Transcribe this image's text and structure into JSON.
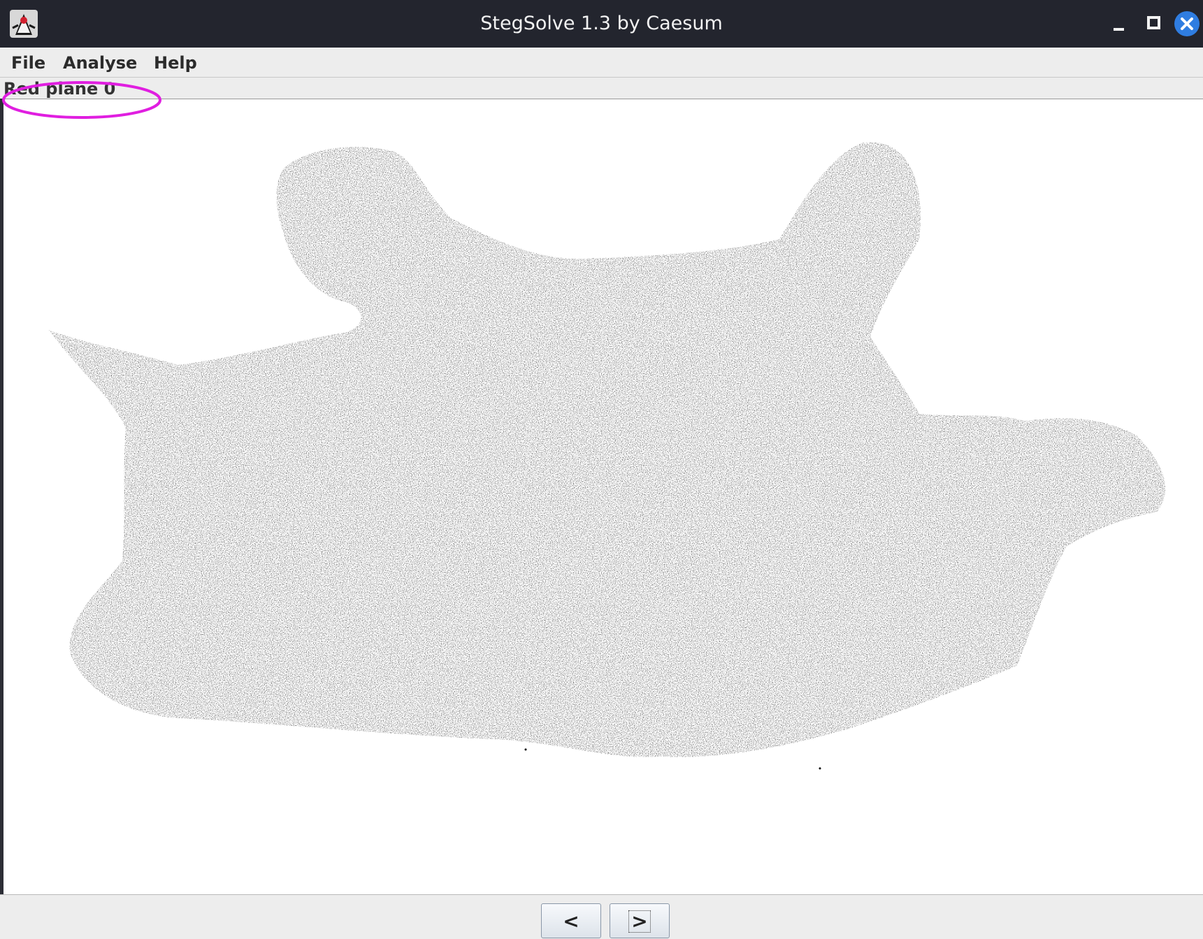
{
  "window": {
    "title": "StegSolve 1.3 by Caesum",
    "icons": [
      "java-duke-icon",
      "minimize-icon",
      "maximize-icon",
      "close-icon"
    ],
    "accent_close": "#2f7de1"
  },
  "menubar": {
    "items": [
      {
        "label": "File"
      },
      {
        "label": "Analyse"
      },
      {
        "label": "Help"
      }
    ]
  },
  "viewer": {
    "plane_label": "Red plane 0",
    "annotation_color": "#e01ee0",
    "image_description_colors": {
      "foreground": "#000000",
      "background": "#ffffff"
    }
  },
  "navigation": {
    "prev_label": "<",
    "next_label": ">"
  }
}
